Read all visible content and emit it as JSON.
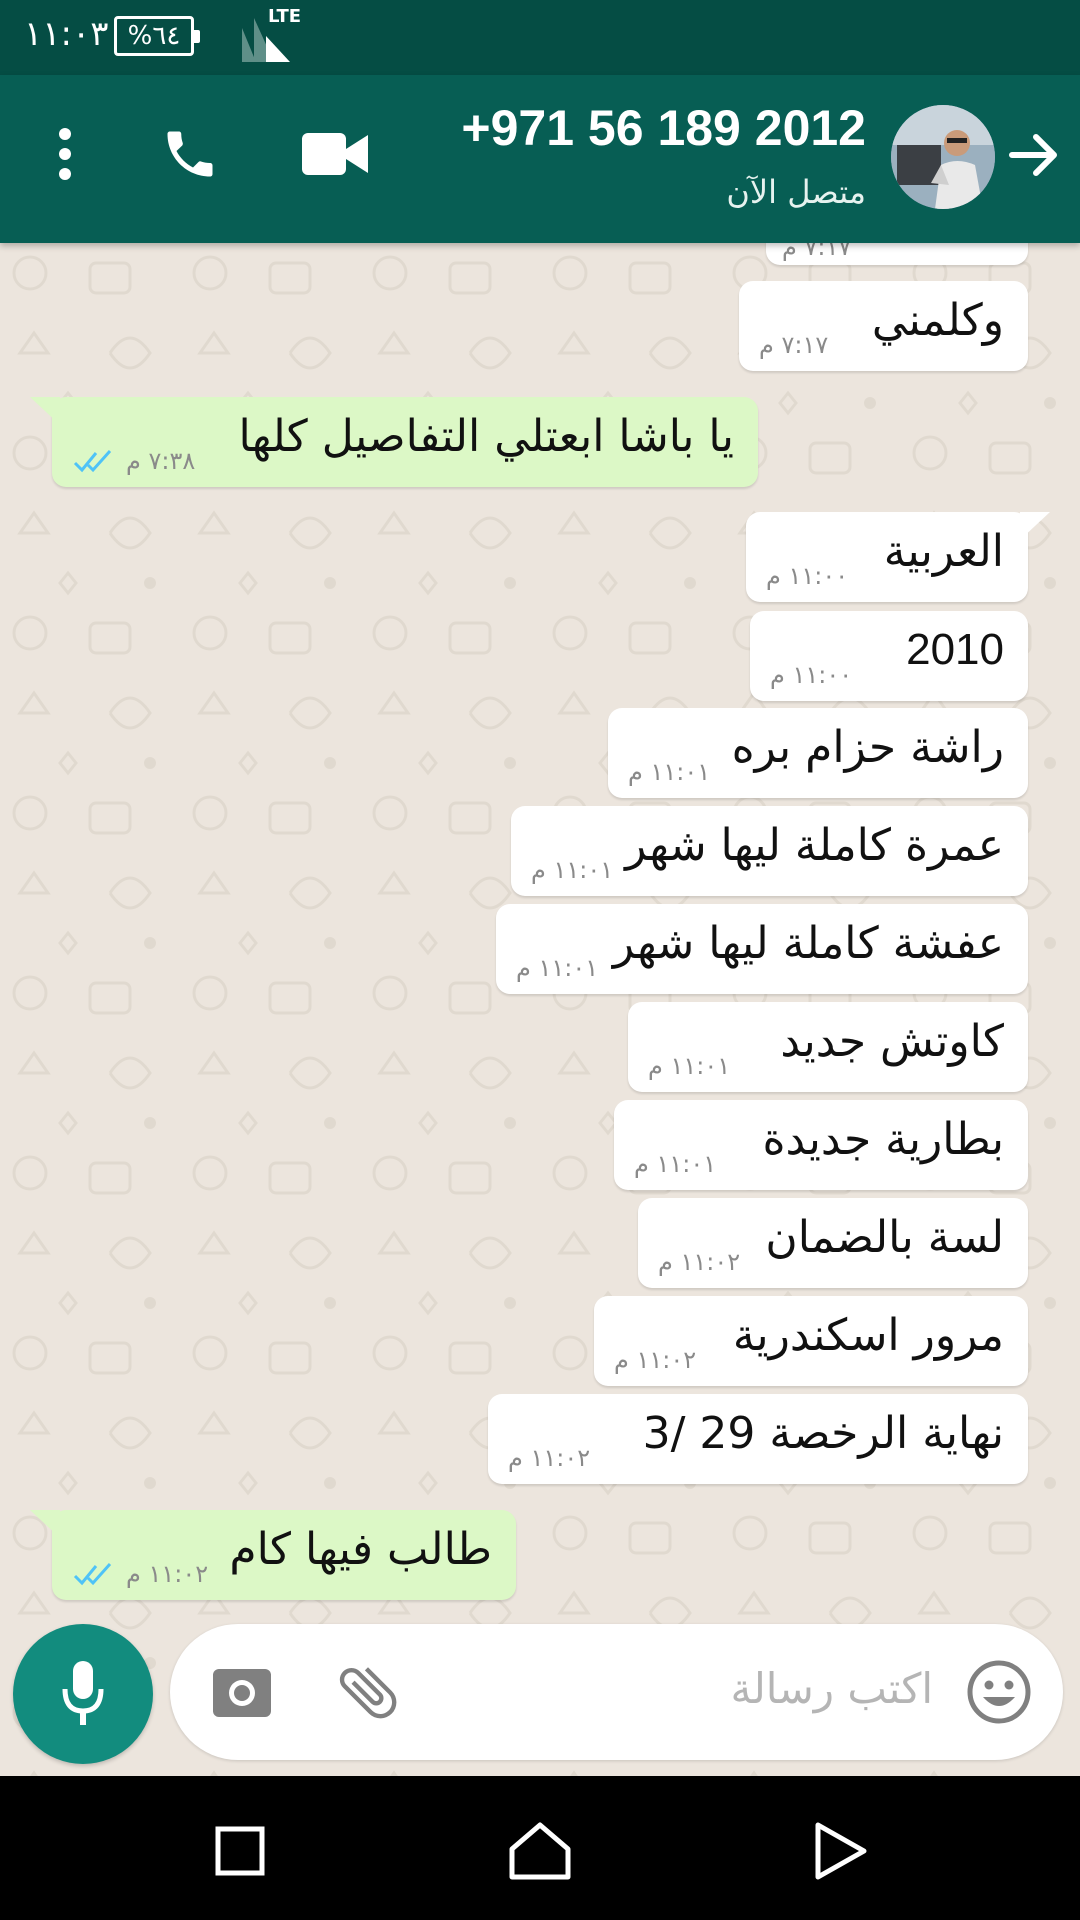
{
  "status_bar": {
    "time": "١١:٠٣",
    "battery": "%٦٤",
    "network": "LTE"
  },
  "header": {
    "contact_name": "+971 56 189 2012",
    "contact_status": "متصل الآن",
    "icons": [
      "back-arrow-icon",
      "avatar",
      "video-call-icon",
      "voice-call-icon",
      "more-options-icon"
    ]
  },
  "messages": [
    {
      "direction": "in",
      "text": "",
      "time": "٧:١٧ م",
      "partial": true
    },
    {
      "direction": "in",
      "text": "وكلمني",
      "time": "٧:١٧ م"
    },
    {
      "direction": "out",
      "text": "يا باشا ابعتلي التفاصيل كلها",
      "time": "٧:٣٨ م",
      "status": "read"
    },
    {
      "direction": "in",
      "text": "العربية",
      "time": "١١:٠٠ م"
    },
    {
      "direction": "in",
      "text": "2010",
      "time": "١١:٠٠ م"
    },
    {
      "direction": "in",
      "text": "راشة حزام بره",
      "time": "١١:٠١ م"
    },
    {
      "direction": "in",
      "text": "عمرة كاملة ليها شهر",
      "time": "١١:٠١ م"
    },
    {
      "direction": "in",
      "text": "عفشة كاملة ليها شهر",
      "time": "١١:٠١ م"
    },
    {
      "direction": "in",
      "text": "كاوتش جديد",
      "time": "١١:٠١ م"
    },
    {
      "direction": "in",
      "text": "بطارية جديدة",
      "time": "١١:٠١ م"
    },
    {
      "direction": "in",
      "text": "لسة بالضمان",
      "time": "١١:٠٢ م"
    },
    {
      "direction": "in",
      "text": "مرور اسكندرية",
      "time": "١١:٠٢ م"
    },
    {
      "direction": "in",
      "text": "نهاية الرخصة 29 /3",
      "time": "١١:٠٢ م"
    },
    {
      "direction": "out",
      "text": "طالب فيها كام",
      "time": "١١:٠٢ م",
      "status": "read"
    }
  ],
  "input": {
    "placeholder": "اكتب رسالة"
  },
  "colors": {
    "header": "#075e54",
    "status_bar": "#054d44",
    "incoming_bubble": "#ffffff",
    "outgoing_bubble": "#dcf8c6",
    "read_ticks": "#4fc3f7",
    "mic_button": "#128c7e",
    "chat_background": "#ece5dd"
  }
}
